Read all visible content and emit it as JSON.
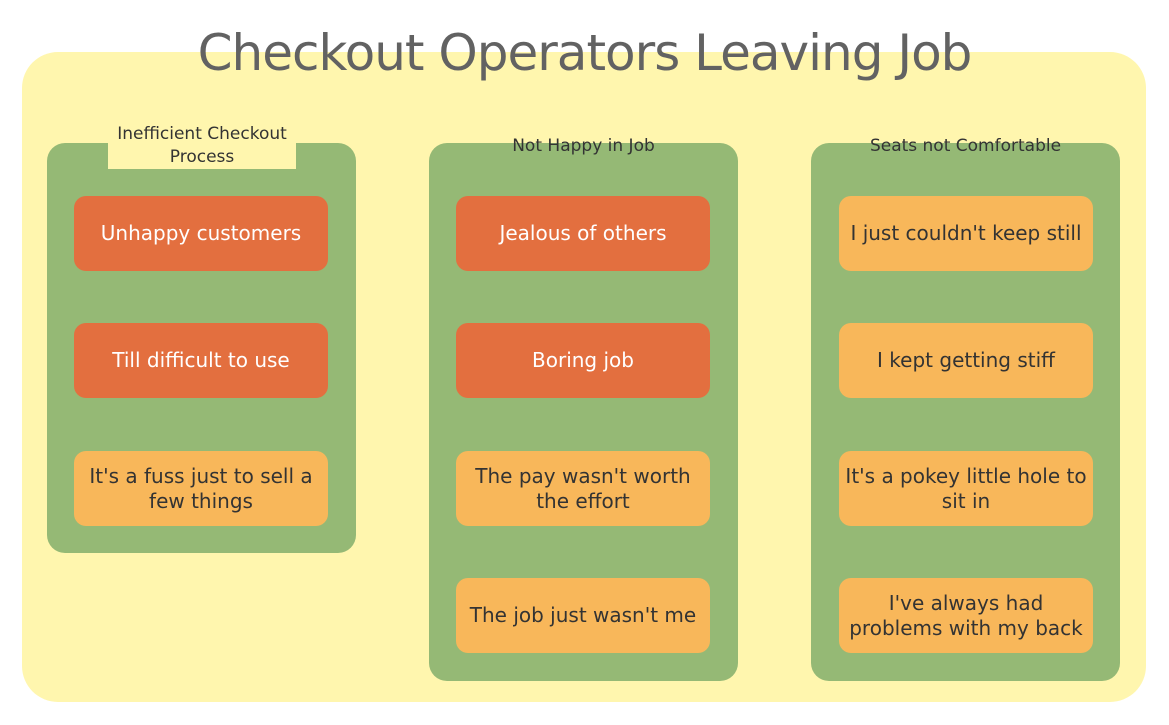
{
  "title": "Checkout Operators Leaving Job",
  "colors": {
    "background": "#fff6ae",
    "group": "#95b975",
    "primary_card": "#e36f3f",
    "secondary_card": "#f8b75a"
  },
  "groups": [
    {
      "label": "Inefficient Checkout\nProcess",
      "items": [
        {
          "text": "Unhappy customers",
          "level": "primary"
        },
        {
          "text": "Till difficult to use",
          "level": "primary"
        },
        {
          "text": "It's a fuss just to sell a few things",
          "level": "secondary"
        }
      ]
    },
    {
      "label": "Not Happy in Job",
      "items": [
        {
          "text": "Jealous of others",
          "level": "primary"
        },
        {
          "text": "Boring job",
          "level": "primary"
        },
        {
          "text": "The pay wasn't worth the effort",
          "level": "secondary"
        },
        {
          "text": "The job just wasn't me",
          "level": "secondary"
        }
      ]
    },
    {
      "label": "Seats not Comfortable",
      "items": [
        {
          "text": "I just couldn't keep still",
          "level": "secondary"
        },
        {
          "text": "I kept getting stiff",
          "level": "secondary"
        },
        {
          "text": "It's a pokey little hole to sit in",
          "level": "secondary"
        },
        {
          "text": "I've always had problems with my back",
          "level": "secondary"
        }
      ]
    }
  ]
}
